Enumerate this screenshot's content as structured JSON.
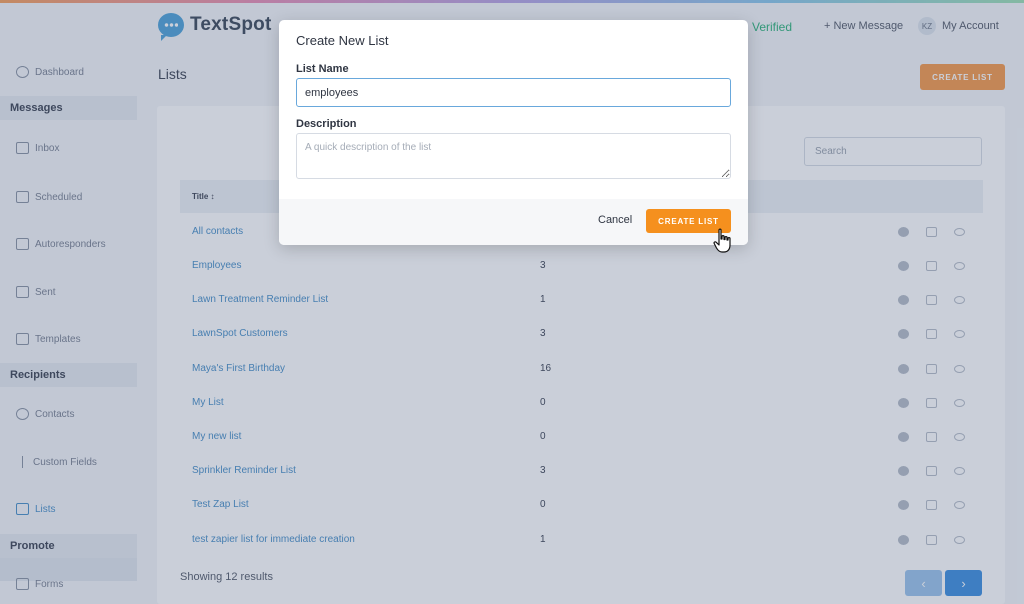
{
  "header": {
    "brand": "TextSpot",
    "verified": "Verified",
    "new_message": "+ New Message",
    "account_initials": "KZ",
    "account_label": "My Account"
  },
  "sidebar": {
    "dashboard": "Dashboard",
    "section_messages": "Messages",
    "inbox": "Inbox",
    "scheduled": "Scheduled",
    "autoresponders": "Autoresponders",
    "sent": "Sent",
    "templates": "Templates",
    "section_recipients": "Recipients",
    "contacts": "Contacts",
    "custom_fields": "Custom Fields",
    "lists": "Lists",
    "section_promote": "Promote",
    "forms": "Forms"
  },
  "main": {
    "title": "Lists",
    "create_button": "CREATE LIST",
    "search_placeholder": "Search",
    "col_title": "Title",
    "rows": [
      {
        "name": "All contacts",
        "count": ""
      },
      {
        "name": "Employees",
        "count": "3"
      },
      {
        "name": "Lawn Treatment Reminder List",
        "count": "1"
      },
      {
        "name": "LawnSpot Customers",
        "count": "3"
      },
      {
        "name": "Maya's First Birthday",
        "count": "16"
      },
      {
        "name": "My List",
        "count": "0"
      },
      {
        "name": "My new list",
        "count": "0"
      },
      {
        "name": "Sprinkler Reminder List",
        "count": "3"
      },
      {
        "name": "Test Zap List",
        "count": "0"
      },
      {
        "name": "test zapier list for immediate creation",
        "count": "1"
      }
    ],
    "showing": "Showing 12 results",
    "prev": "‹",
    "next": "›"
  },
  "modal": {
    "title": "Create New List",
    "name_label": "List Name",
    "name_value": "employees",
    "description_label": "Description",
    "description_placeholder": "A quick description of the list",
    "cancel": "Cancel",
    "create": "CREATE LIST"
  },
  "colors": {
    "accent_orange": "#f5901e",
    "link_blue": "#4a90c8",
    "verified_green": "#2fb37a"
  }
}
